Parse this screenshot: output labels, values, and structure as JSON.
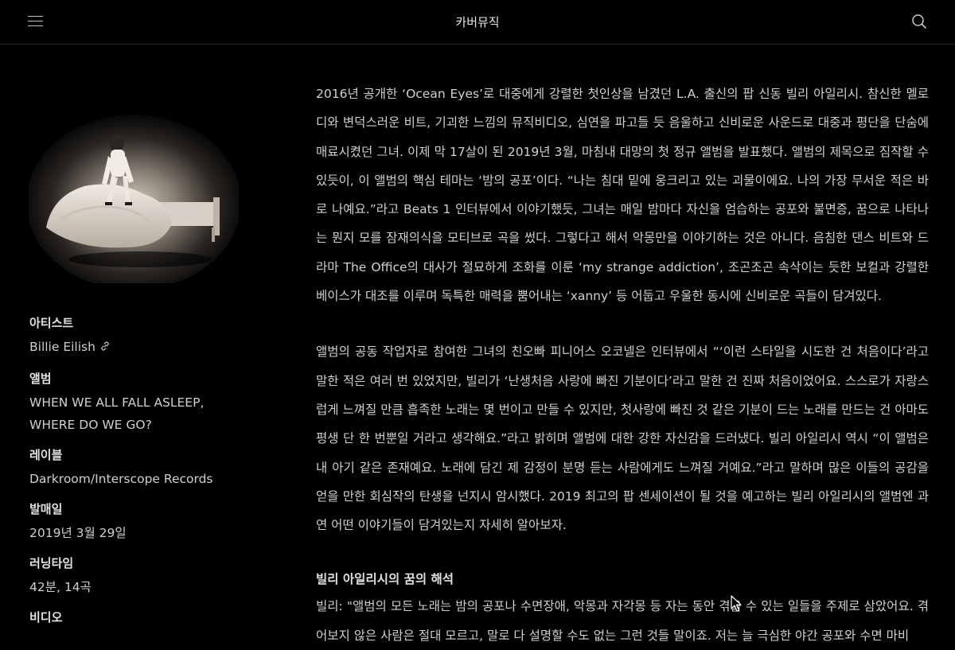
{
  "header": {
    "title": "카버뮤직",
    "menu_icon": "hamburger-menu-icon",
    "search_icon": "search-icon"
  },
  "sidebar": {
    "artist_label": "아티스트",
    "artist_value": "Billie Eilish",
    "album_label": "앨범",
    "album_value": "WHEN WE ALL FALL ASLEEP, WHERE DO WE GO?",
    "label_label": "레이블",
    "label_value": "Darkroom/Interscope Records",
    "release_label": "발매일",
    "release_value": "2019년 3월 29일",
    "runtime_label": "러닝타임",
    "runtime_value": "42분, 14곡",
    "video_label": "비디오"
  },
  "article": {
    "p1": "2016년 공개한 ‘Ocean Eyes’로 대중에게 강렬한 첫인상을 남겼던 L.A. 출신의 팝 신동 빌리 아일리시. 참신한 멜로디와 변덕스러운 비트, 기괴한 느낌의 뮤직비디오, 심연을 파고들 듯 음울하고 신비로운 사운드로 대중과 평단을 단숨에 매료시켰던 그녀. 이제 막 17살이 된 2019년 3월, 마침내 대망의 첫 정규 앨범을 발표했다. 앨범의 제목으로 짐작할 수 있듯이, 이 앨범의 핵심 테마는 ‘밤의 공포’이다. “나는 침대 밑에 웅크리고 있는 괴물이에요. 나의 가장 무서운 적은 바로 나예요.”라고 Beats 1 인터뷰에서 이야기했듯, 그녀는 매일 밤마다 자신을 엄습하는 공포와 불면증, 꿈으로 나타나는 뭔지 모를 잠재의식을 모티브로 곡을 썼다. 그렇다고 해서 악몽만을 이야기하는 것은 아니다. 음침한 댄스 비트와 드라마 The Office의 대사가 절묘하게 조화를 이룬 ‘my strange addiction’, 조곤조곤 속삭이는 듯한 보컬과 강렬한 베이스가 대조를 이루며 독특한 매력을 뿜어내는 ‘xanny’ 등 어둡고 우울한 동시에 신비로운 곡들이 담겨있다.",
    "p2": "앨범의 공동 작업자로 참여한 그녀의 친오빠 피니어스 오코넬은 인터뷰에서 “‘이런 스타일을 시도한 건 처음이다’라고 말한 적은 여러 번 있었지만, 빌리가 ‘난생처음 사랑에 빠진 기분이다’라고 말한 건 진짜 처음이었어요. 스스로가 자랑스럽게 느껴질 만큼 흡족한 노래는 몇 번이고 만들 수 있지만, 첫사랑에 빠진 것 같은 기분이 드는 노래를 만드는 건 아마도 평생 단 한 번뿐일 거라고 생각해요.”라고 밝히며 앨범에 대한 강한 자신감을 드러냈다. 빌리 아일리시 역시 “이 앨범은 내 아기 같은 존재예요. 노래에 담긴 제 감정이 분명 듣는 사람에게도 느껴질 거예요.”라고 말하며 많은 이들의 공감을 얻을 만한 회심작의 탄생을 넌지시 암시했다. 2019 최고의 팝 센세이션이 될 것을 예고하는 빌리 아일리시의 앨범엔 과연 어떤 이야기들이 담겨있는지 자세히 알아보자.",
    "heading": "빌리 아일리시의 꿈의 해석",
    "p3": "빌리: \"앨범의 모든 노래는 밤의 공포나 수면장애, 악몽과 자각몽 등 자는 동안 겪을 수 있는 일들을 주제로 삼았어요. 겪어보지 않은 사람은 절대 모르고, 말로 다 설명할 수도 없는 그런 것들 말이죠. 저는 늘 극심한 야간 공포와 수면 마비"
  },
  "colors": {
    "background": "#000000",
    "text": "#d0d0d0",
    "divider": "#2b2b2b"
  }
}
